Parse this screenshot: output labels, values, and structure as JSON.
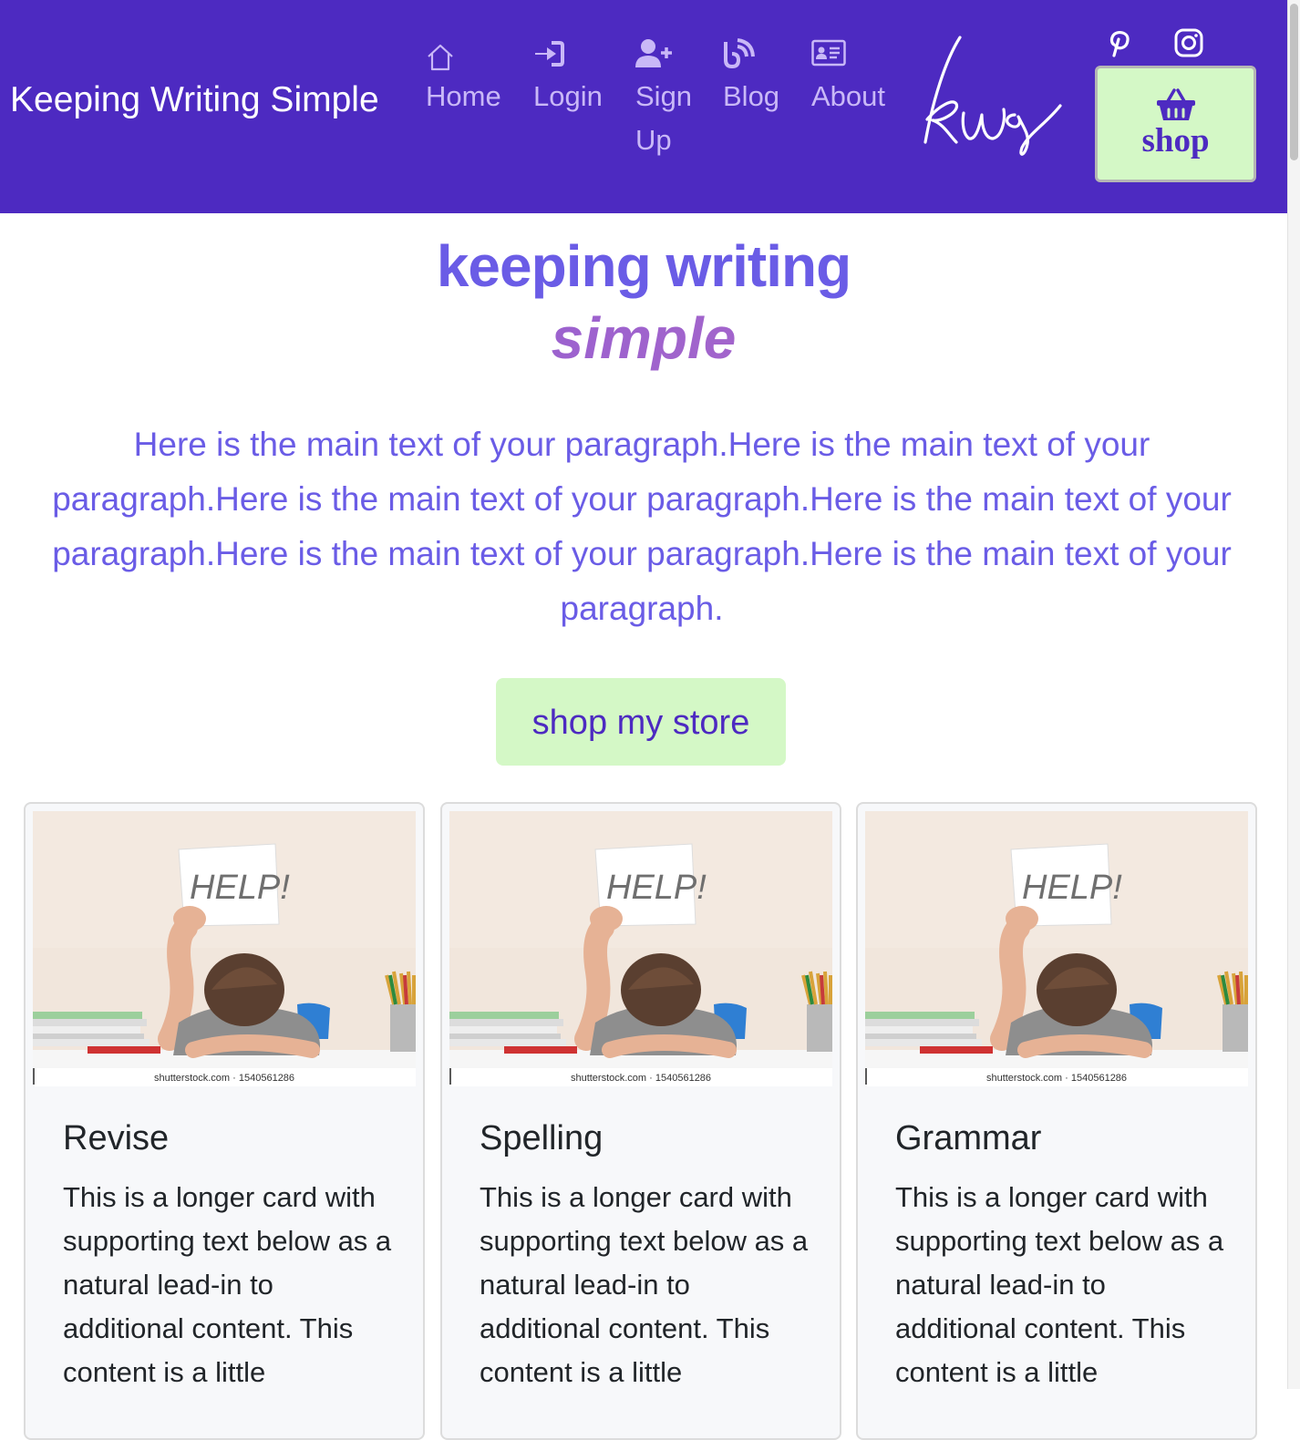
{
  "navbar": {
    "brand": "Keeping Writing Simple",
    "items": [
      {
        "label": "Home",
        "icon": "home-icon"
      },
      {
        "label": "Login",
        "icon": "login-icon"
      },
      {
        "label": "Sign Up",
        "icon": "user-plus-icon"
      },
      {
        "label": "Blog",
        "icon": "blog-rss-icon"
      },
      {
        "label": "About",
        "icon": "id-card-icon"
      }
    ],
    "logo_text": "kws",
    "social": [
      "pinterest-icon",
      "instagram-icon"
    ],
    "shop_label": "shop",
    "colors": {
      "background": "#4d2ac1",
      "nav_text": "#c9b8f7",
      "shop_bg": "#d4f8c6"
    }
  },
  "hero": {
    "title": "keeping writing",
    "subtitle": "simple",
    "paragraph": "Here is the main text of your paragraph.Here is the main text of your paragraph.Here is the main text of your paragraph.Here is the main text of your paragraph.Here is the main text of your paragraph.Here is the main text of your paragraph.",
    "button_label": "shop my store",
    "colors": {
      "title": "#6a5ce6",
      "subtitle": "#9b5fd3",
      "button_bg": "#d4f8c6"
    }
  },
  "cards": [
    {
      "image_caption": "shutterstock.com · 1540561286",
      "image_sign": "HELP!",
      "title": "Revise",
      "text": "This is a longer card with supporting text below as a natural lead-in to additional content. This content is a little"
    },
    {
      "image_caption": "shutterstock.com · 1540561286",
      "image_sign": "HELP!",
      "title": "Spelling",
      "text": "This is a longer card with supporting text below as a natural lead-in to additional content. This content is a little"
    },
    {
      "image_caption": "shutterstock.com · 1540561286",
      "image_sign": "HELP!",
      "title": "Grammar",
      "text": "This is a longer card with supporting text below as a natural lead-in to additional content. This content is a little"
    }
  ]
}
